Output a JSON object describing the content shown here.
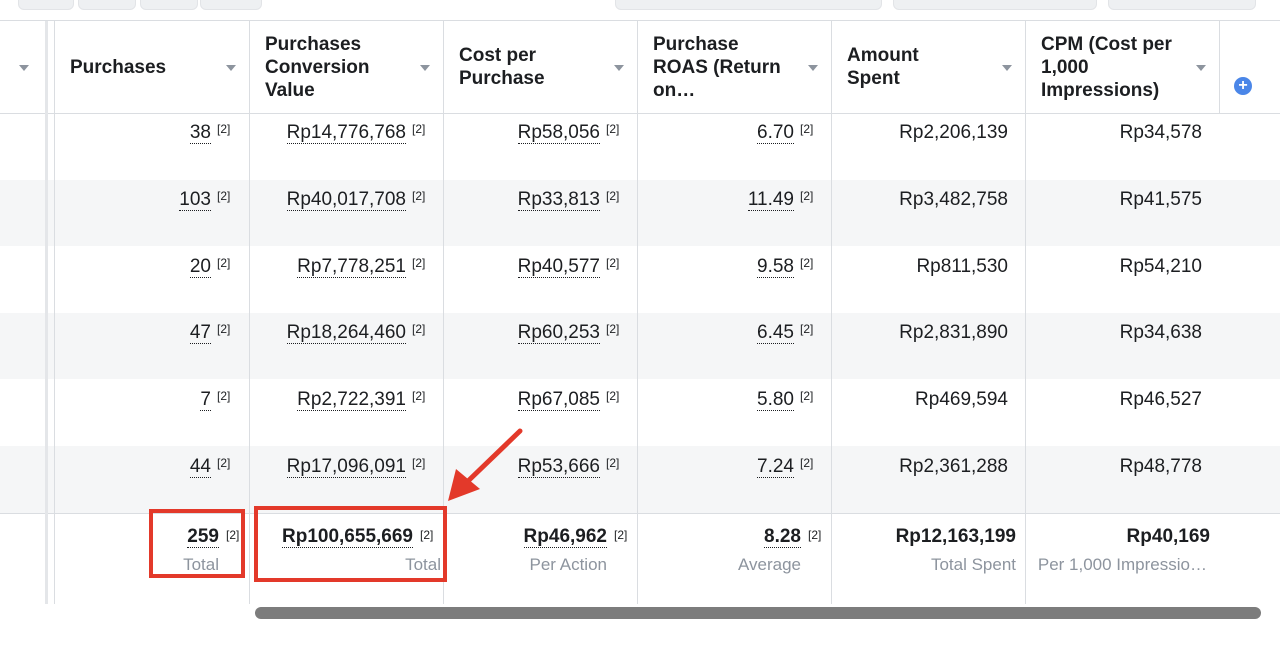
{
  "columns": [
    {
      "label": "Purchases"
    },
    {
      "label": "Purchases Conversion Value"
    },
    {
      "label": "Cost per Purchase"
    },
    {
      "label": "Purchase ROAS (Return on…"
    },
    {
      "label": "Amount Spent"
    },
    {
      "label": "CPM (Cost per 1,000 Impressions)"
    }
  ],
  "rows": [
    {
      "purchases": "38",
      "conv_value": "Rp14,776,768",
      "cost_per": "Rp58,056",
      "roas": "6.70",
      "spent": "Rp2,206,139",
      "cpm": "Rp34,578"
    },
    {
      "purchases": "103",
      "conv_value": "Rp40,017,708",
      "cost_per": "Rp33,813",
      "roas": "11.49",
      "spent": "Rp3,482,758",
      "cpm": "Rp41,575"
    },
    {
      "purchases": "20",
      "conv_value": "Rp7,778,251",
      "cost_per": "Rp40,577",
      "roas": "9.58",
      "spent": "Rp811,530",
      "cpm": "Rp54,210"
    },
    {
      "purchases": "47",
      "conv_value": "Rp18,264,460",
      "cost_per": "Rp60,253",
      "roas": "6.45",
      "spent": "Rp2,831,890",
      "cpm": "Rp34,638"
    },
    {
      "purchases": "7",
      "conv_value": "Rp2,722,391",
      "cost_per": "Rp67,085",
      "roas": "5.80",
      "spent": "Rp469,594",
      "cpm": "Rp46,527"
    },
    {
      "purchases": "44",
      "conv_value": "Rp17,096,091",
      "cost_per": "Rp53,666",
      "roas": "7.24",
      "spent": "Rp2,361,288",
      "cpm": "Rp48,778"
    }
  ],
  "footnote": "[2]",
  "totals": {
    "purchases": {
      "value": "259",
      "label": "Total"
    },
    "conv_value": {
      "value": "Rp100,655,669",
      "label": "Total"
    },
    "cost_per": {
      "value": "Rp46,962",
      "label": "Per Action"
    },
    "roas": {
      "value": "8.28",
      "label": "Average"
    },
    "spent": {
      "value": "Rp12,163,199",
      "label": "Total Spent"
    },
    "cpm": {
      "value": "Rp40,169",
      "label": "Per 1,000 Impressio…"
    }
  },
  "icons": {
    "add_column": "plus-circle-icon",
    "sort": "chevron-down-icon"
  },
  "colors": {
    "highlight": "#e3392a",
    "link_underline": "#1c1e21",
    "add_button": "#4a86e8"
  }
}
